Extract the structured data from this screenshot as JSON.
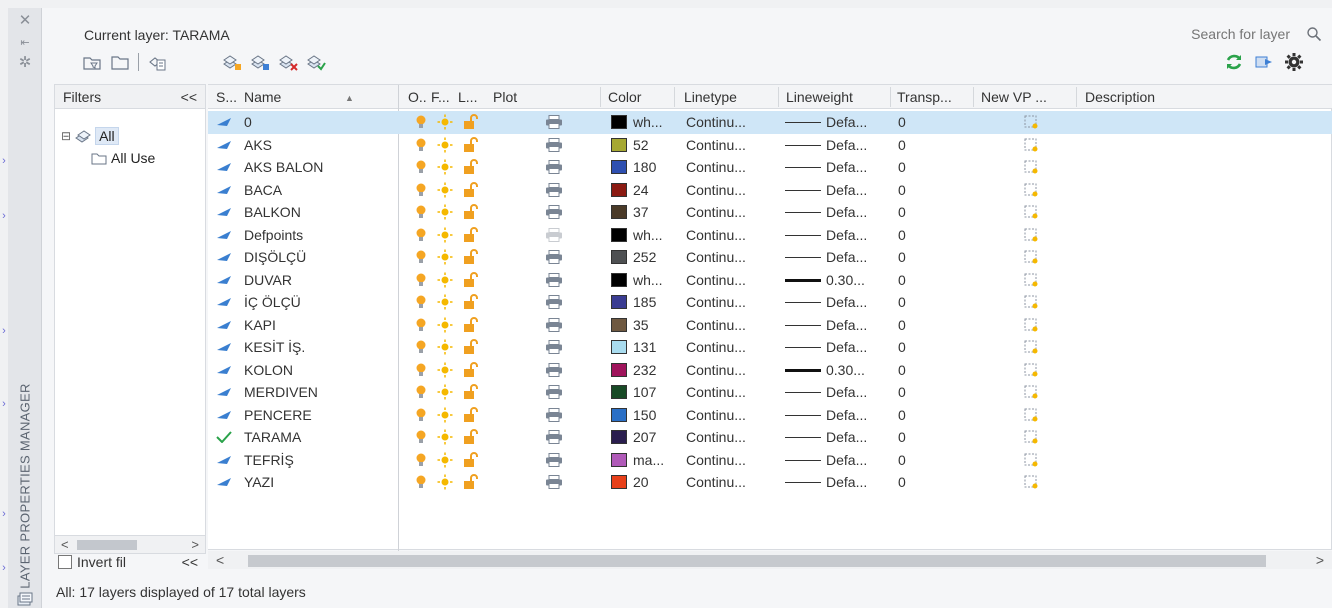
{
  "panel": {
    "vertical_title": "LAYER PROPERTIES MANAGER",
    "controls": [
      "close-icon",
      "autohide-icon",
      "properties-icon"
    ]
  },
  "header": {
    "current_layer": "Current layer: TARAMA",
    "search_placeholder": "Search for layer"
  },
  "toolbar": {
    "left_icons": [
      "new-property-filter-icon",
      "new-group-filter-icon",
      "layer-states-manager-icon"
    ],
    "mid_icons": [
      "new-layer-icon",
      "new-layer-vp-frozen-icon",
      "delete-layer-icon",
      "set-current-icon"
    ],
    "right_icons": [
      "refresh-icon",
      "update-icon",
      "settings-icon"
    ],
    "accent_green": "#2aa24a",
    "accent_blue": "#3d7fd4"
  },
  "filters": {
    "title": "Filters",
    "collapse": "<<",
    "tree": [
      {
        "label": "All",
        "selected": true
      },
      {
        "label": "All Use",
        "selected": false
      }
    ],
    "invert_label": "Invert fil",
    "invert_collapse": "<<",
    "scroll_left": "<",
    "scroll_right": ">"
  },
  "columns": {
    "status": "S...",
    "name": "Name",
    "sort_arrow": "▲",
    "on": "O..",
    "freeze": "F...",
    "lock": "L...",
    "plot": "Plot",
    "color": "Color",
    "linetype": "Linetype",
    "lineweight": "Lineweight",
    "transparency": "Transp...",
    "new_vp": "New VP ...",
    "description": "Description"
  },
  "layers": [
    {
      "name": "0",
      "color": "wh...",
      "swatch": "#000000",
      "linetype": "Continu...",
      "lineweight": "Defa...",
      "thick": false,
      "transparency": "0",
      "plot": true,
      "current": false,
      "active": true
    },
    {
      "name": "AKS",
      "color": "52",
      "swatch": "#a6a832",
      "linetype": "Continu...",
      "lineweight": "Defa...",
      "thick": false,
      "transparency": "0",
      "plot": true,
      "current": false,
      "active": false
    },
    {
      "name": "AKS BALON",
      "color": "180",
      "swatch": "#2e4fb0",
      "linetype": "Continu...",
      "lineweight": "Defa...",
      "thick": false,
      "transparency": "0",
      "plot": true,
      "current": false,
      "active": false
    },
    {
      "name": "BACA",
      "color": "24",
      "swatch": "#8b1a12",
      "linetype": "Continu...",
      "lineweight": "Defa...",
      "thick": false,
      "transparency": "0",
      "plot": true,
      "current": false,
      "active": false
    },
    {
      "name": "BALKON",
      "color": "37",
      "swatch": "#4a3a28",
      "linetype": "Continu...",
      "lineweight": "Defa...",
      "thick": false,
      "transparency": "0",
      "plot": true,
      "current": false,
      "active": false
    },
    {
      "name": "Defpoints",
      "color": "wh...",
      "swatch": "#000000",
      "linetype": "Continu...",
      "lineweight": "Defa...",
      "thick": false,
      "transparency": "0",
      "plot": false,
      "current": false,
      "active": false
    },
    {
      "name": "DIŞÖLÇÜ",
      "color": "252",
      "swatch": "#4e5052",
      "linetype": "Continu...",
      "lineweight": "Defa...",
      "thick": false,
      "transparency": "0",
      "plot": true,
      "current": false,
      "active": false
    },
    {
      "name": "DUVAR",
      "color": "wh...",
      "swatch": "#000000",
      "linetype": "Continu...",
      "lineweight": "0.30...",
      "thick": true,
      "transparency": "0",
      "plot": true,
      "current": false,
      "active": false
    },
    {
      "name": "İÇ ÖLÇÜ",
      "color": "185",
      "swatch": "#3a3c92",
      "linetype": "Continu...",
      "lineweight": "Defa...",
      "thick": false,
      "transparency": "0",
      "plot": true,
      "current": false,
      "active": false
    },
    {
      "name": "KAPI",
      "color": "35",
      "swatch": "#6e5840",
      "linetype": "Continu...",
      "lineweight": "Defa...",
      "thick": false,
      "transparency": "0",
      "plot": true,
      "current": false,
      "active": false
    },
    {
      "name": "KESİT İŞ.",
      "color": "131",
      "swatch": "#a9dcef",
      "linetype": "Continu...",
      "lineweight": "Defa...",
      "thick": false,
      "transparency": "0",
      "plot": true,
      "current": false,
      "active": false
    },
    {
      "name": "KOLON",
      "color": "232",
      "swatch": "#a0145c",
      "linetype": "Continu...",
      "lineweight": "0.30...",
      "thick": true,
      "transparency": "0",
      "plot": true,
      "current": false,
      "active": false
    },
    {
      "name": "MERDIVEN",
      "color": "107",
      "swatch": "#184a26",
      "linetype": "Continu...",
      "lineweight": "Defa...",
      "thick": false,
      "transparency": "0",
      "plot": true,
      "current": false,
      "active": false
    },
    {
      "name": "PENCERE",
      "color": "150",
      "swatch": "#2a6fc6",
      "linetype": "Continu...",
      "lineweight": "Defa...",
      "thick": false,
      "transparency": "0",
      "plot": true,
      "current": false,
      "active": false
    },
    {
      "name": "TARAMA",
      "color": "207",
      "swatch": "#2a1e4e",
      "linetype": "Continu...",
      "lineweight": "Defa...",
      "thick": false,
      "transparency": "0",
      "plot": true,
      "current": true,
      "active": false
    },
    {
      "name": "TEFRİŞ",
      "color": "ma...",
      "swatch": "#b05ab8",
      "linetype": "Continu...",
      "lineweight": "Defa...",
      "thick": false,
      "transparency": "0",
      "plot": true,
      "current": false,
      "active": false
    },
    {
      "name": "YAZI",
      "color": "20",
      "swatch": "#e8401a",
      "linetype": "Continu...",
      "lineweight": "Defa...",
      "thick": false,
      "transparency": "0",
      "plot": true,
      "current": false,
      "active": false
    }
  ],
  "list_scroll": {
    "left": "<",
    "right": ">"
  },
  "footer": "All: 17 layers displayed of 17 total layers",
  "colors": {
    "active_row": "#cfe6f7",
    "bulb": "#f5a623",
    "sun": "#f5b800",
    "lock": "#f0a020",
    "status_blue": "#3a7fd0",
    "check_green": "#2aa24a"
  }
}
